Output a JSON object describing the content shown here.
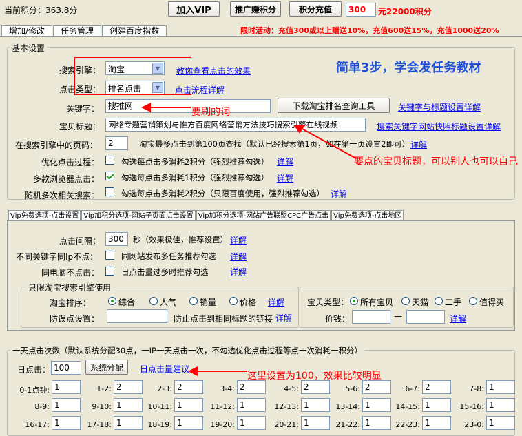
{
  "top": {
    "points_label": "当前积分：",
    "points_value": "363.8分",
    "buy_vip": "加入VIP",
    "promote_points": "推广赚积分",
    "recharge": "积分充值",
    "recharge_amount": "300",
    "recharge_note": "元22000积分",
    "promo": "限时活动：充值300或以上赠送10%，充值600送15%，充值1000送20%"
  },
  "tabs": [
    "增加/修改",
    "任务管理",
    "创建百度指数"
  ],
  "basic": {
    "legend": "基本设置",
    "slogan": "简单3步，学会发任务教材",
    "engine_label": "搜索引擎：",
    "engine_value": "淘宝",
    "engine_link": "教你查看点击的效果",
    "click_type_label": "点击类型：",
    "click_type_value": "排名点击",
    "click_type_link": "点击流程详解",
    "keyword_label": "关键字：",
    "keyword_value": "搜推网",
    "keyword_note": "要刷的词",
    "download_tool": "下载淘宝排名查询工具",
    "keyword_link": "关键字与标题设置详解",
    "title_label": "宝贝标题：",
    "title_value": "网络专题营销策划与推方百度网络营销方法技巧搜索引擎在线视频",
    "title_link": "搜索关键字网站快照标题设置详解",
    "page_label": "在搜索引擎中的页码：",
    "page_value": "2",
    "page_note": "淘宝最多点击到第100页查找（默认已经搜索第1页，如在第一页设置2即可）",
    "detail": "详解",
    "optimize_label": "优化点击过程：",
    "optimize_note": "勾选每点击多消耗2积分（强烈推荐勾选）",
    "browser_label": "多款浏览器点击：",
    "browser_note": "勾选每点击多消耗1积分（强烈推荐勾选）",
    "random_label": "随机多次相关搜索：",
    "random_note": "勾选每点击多消耗2积分（只限百度使用，强烈推荐勾选）",
    "title_annotation": "要点的宝贝标题，可以别人也可以自己"
  },
  "vip_tabs": [
    "Vip免费选项-点击设置",
    "Vip加积分选项-网站子页面点击设置",
    "Vip加积分选项-网站广告联盟CPC广告点击",
    "Vip免费选项-点击地区"
  ],
  "vip": {
    "interval_label": "点击间隔：",
    "interval_value": "300",
    "interval_note": "秒（效果极佳，推荐设置）",
    "diff_ip_label": "不同关键字同Ip不点：",
    "diff_ip_note": "同网站发布多任务推荐勾选",
    "same_pc_label": "同电脑不点击：",
    "same_pc_note": "日点击量过多时推荐勾选",
    "detail": "详解",
    "taobao_legend": "只限淘宝搜索引擎使用",
    "sort_label": "淘宝排序：",
    "sort_options": [
      "综合",
      "人气",
      "销量",
      "价格"
    ],
    "mistake_label": "防误点设置：",
    "mistake_note": "防止点击到相同标题的链接",
    "type_label": "宝贝类型：",
    "type_options": [
      "所有宝贝",
      "天猫",
      "二手",
      "值得买"
    ],
    "price_label": "价钱：",
    "price_sep": "—"
  },
  "daily": {
    "legend": "一天点击次数（默认系统分配30点，一IP一天点击一次，不勾选优化点击过程等点一次消耗一积分）",
    "daily_label": "日点击：",
    "daily_value": "100",
    "auto_assign": "系统分配",
    "suggest_link": "日点击量建议",
    "annotation": "这里设置为100，效果比较明显",
    "hours": [
      {
        "label": "0-1点钟:",
        "value": "1"
      },
      {
        "label": "1-2:",
        "value": "2"
      },
      {
        "label": "2-3:",
        "value": "2"
      },
      {
        "label": "3-4:",
        "value": "2"
      },
      {
        "label": "4-5:",
        "value": "2"
      },
      {
        "label": "5-6:",
        "value": "2"
      },
      {
        "label": "6-7:",
        "value": "2"
      },
      {
        "label": "7-8:",
        "value": "1"
      },
      {
        "label": "8-9:",
        "value": "1"
      },
      {
        "label": "9-10:",
        "value": "1"
      },
      {
        "label": "10-11:",
        "value": "1"
      },
      {
        "label": "11-12:",
        "value": "1"
      },
      {
        "label": "12-13:",
        "value": "1"
      },
      {
        "label": "13-14:",
        "value": "1"
      },
      {
        "label": "14-15:",
        "value": "1"
      },
      {
        "label": "15-16:",
        "value": "1"
      },
      {
        "label": "16-17:",
        "value": "1"
      },
      {
        "label": "17-18:",
        "value": "1"
      },
      {
        "label": "18-19:",
        "value": "1"
      },
      {
        "label": "19-20:",
        "value": "1"
      },
      {
        "label": "20-21:",
        "value": "1"
      },
      {
        "label": "21-22:",
        "value": "1"
      },
      {
        "label": "22-23:",
        "value": "1"
      },
      {
        "label": "23-0:",
        "value": "1"
      }
    ]
  }
}
